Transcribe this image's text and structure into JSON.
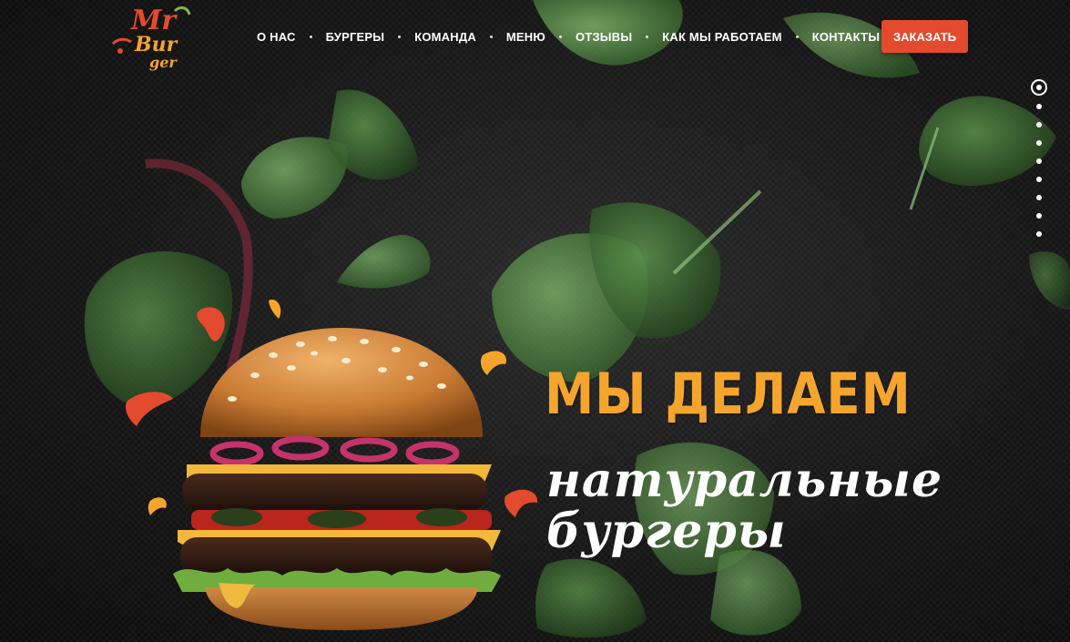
{
  "brand": {
    "logo_line1": "Mr",
    "logo_line2": "Bur",
    "logo_line3": "ger",
    "accent": "#e44a2d",
    "yellow": "#f6a52c"
  },
  "nav": {
    "items": [
      {
        "label": "О НАС"
      },
      {
        "label": "БУРГЕРЫ"
      },
      {
        "label": "КОМАНДА"
      },
      {
        "label": "МЕНЮ"
      },
      {
        "label": "ОТЗЫВЫ"
      },
      {
        "label": "КАК МЫ РАБОТАЕМ"
      },
      {
        "label": "КОНТАКТЫ"
      }
    ],
    "order_label": "ЗАКАЗАТЬ"
  },
  "pager": {
    "total": 9,
    "active": 1
  },
  "hero": {
    "headline_top": "МЫ ДЕЛАЕМ",
    "headline_bottom_1": "натуральные",
    "headline_bottom_2": "бургеры",
    "image": "burger-illustration"
  }
}
